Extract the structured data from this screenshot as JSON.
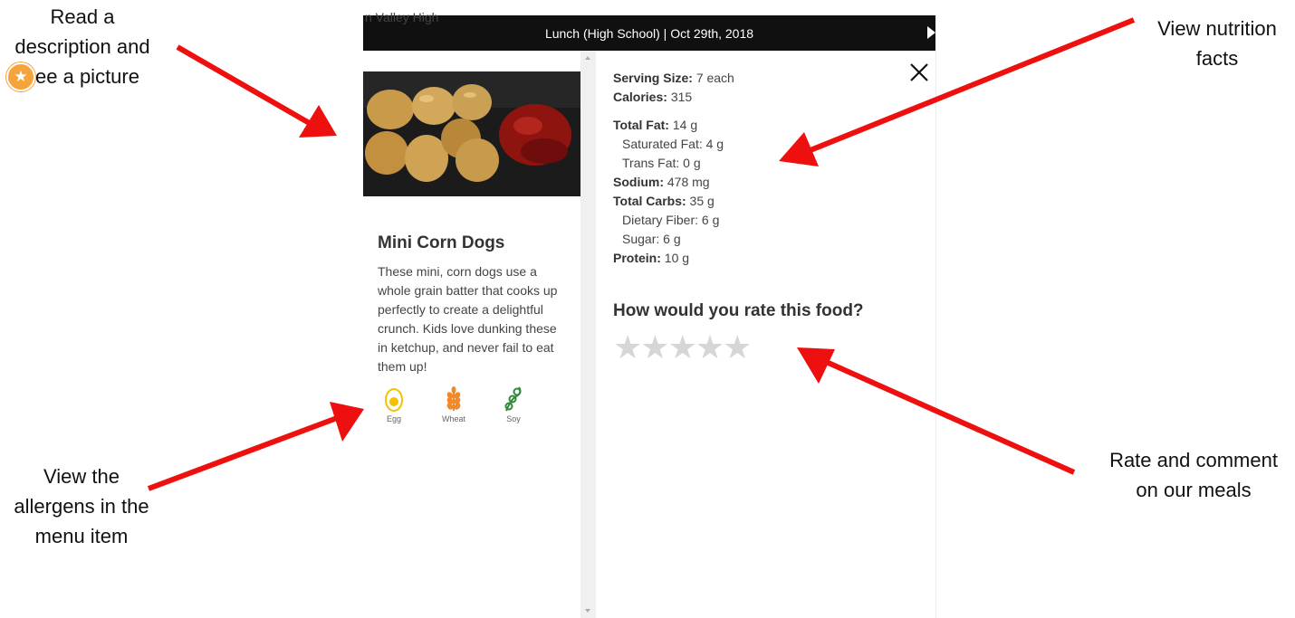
{
  "header": {
    "ghost_text": "n Valley High",
    "title": "Lunch (High School) | Oct 29th, 2018"
  },
  "item": {
    "name": "Mini Corn Dogs",
    "description": "These mini, corn dogs use a whole grain batter that cooks up perfectly to create a delightful crunch. Kids love dunking these in ketchup, and never fail to eat them up!",
    "favorite_icon": "star-icon",
    "allergens": [
      {
        "label": "Egg",
        "icon": "egg-icon",
        "color": "#f2c200"
      },
      {
        "label": "Wheat",
        "icon": "wheat-icon",
        "color": "#ef8a2a"
      },
      {
        "label": "Soy",
        "icon": "soy-icon",
        "color": "#2e8a3a"
      }
    ]
  },
  "nutrition": {
    "serving_size": {
      "label": "Serving Size:",
      "value": "7 each"
    },
    "calories": {
      "label": "Calories:",
      "value": "315"
    },
    "total_fat": {
      "label": "Total Fat:",
      "value": "14 g"
    },
    "saturated_fat": {
      "label": "Saturated Fat:",
      "value": "4 g"
    },
    "trans_fat": {
      "label": "Trans Fat:",
      "value": "0 g"
    },
    "sodium": {
      "label": "Sodium:",
      "value": "478 mg"
    },
    "total_carbs": {
      "label": "Total Carbs:",
      "value": "35 g"
    },
    "dietary_fiber": {
      "label": "Dietary Fiber:",
      "value": "6 g"
    },
    "sugar": {
      "label": "Sugar:",
      "value": "6 g"
    },
    "protein": {
      "label": "Protein:",
      "value": "10 g"
    }
  },
  "rating": {
    "question": "How would you rate this food?",
    "max_stars": 5,
    "current": 0
  },
  "annotations": {
    "picture": "Read a\ndescription and\nsee a picture",
    "nutrition": "View nutrition\nfacts",
    "allergens": "View the\nallergens in the\nmenu item",
    "rate": "Rate and comment\non our meals"
  },
  "colors": {
    "arrow": "#ee0f0f",
    "header_bg": "#101010",
    "favorite": "#f5a33a",
    "star_empty": "#d6d6d6"
  }
}
